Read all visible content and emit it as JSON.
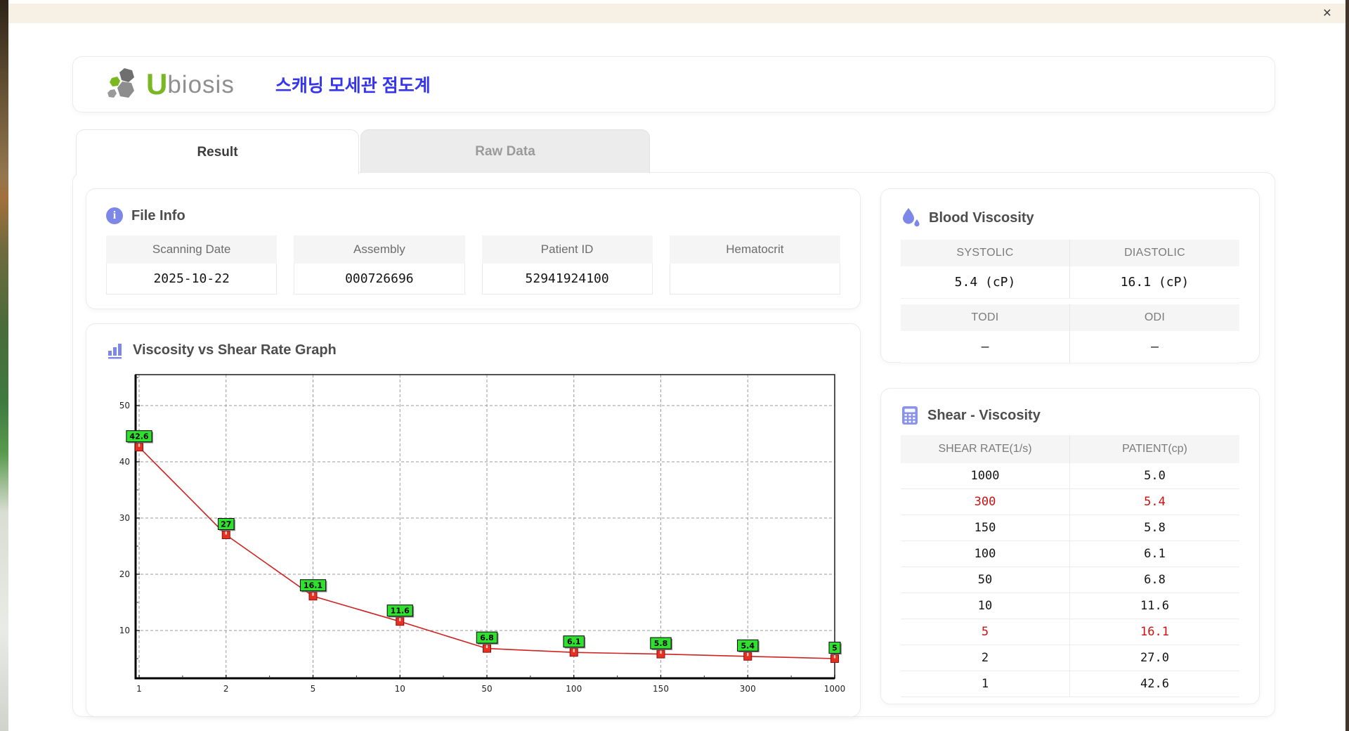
{
  "window": {
    "close_label": "×"
  },
  "header": {
    "logo_u": "U",
    "logo_rest": "biosis",
    "app_title": "스캐닝 모세관 점도계"
  },
  "tabs": [
    {
      "label": "Result",
      "active": true
    },
    {
      "label": "Raw Data",
      "active": false
    }
  ],
  "file_info": {
    "title": "File Info",
    "fields": [
      {
        "label": "Scanning Date",
        "value": "2025-10-22"
      },
      {
        "label": "Assembly",
        "value": "000726696"
      },
      {
        "label": "Patient ID",
        "value": "52941924100"
      },
      {
        "label": "Hematocrit",
        "value": ""
      }
    ]
  },
  "blood_viscosity": {
    "title": "Blood Viscosity",
    "metrics": [
      {
        "label": "SYSTOLIC",
        "value": "5.4 (cP)"
      },
      {
        "label": "DIASTOLIC",
        "value": "16.1 (cP)"
      },
      {
        "label": "TODI",
        "value": "–"
      },
      {
        "label": "ODI",
        "value": "–"
      }
    ]
  },
  "graph": {
    "title": "Viscosity vs Shear Rate Graph"
  },
  "chart_data": {
    "type": "line",
    "x_scale": "categorical",
    "categories": [
      "1",
      "2",
      "5",
      "10",
      "50",
      "100",
      "150",
      "300",
      "1000"
    ],
    "values": [
      42.6,
      27,
      16.1,
      11.6,
      6.8,
      6.1,
      5.8,
      5.4,
      5
    ],
    "point_labels": [
      "42.6",
      "27",
      "16.1",
      "11.6",
      "6.8",
      "6.1",
      "5.8",
      "5.4",
      "5"
    ],
    "title": "Viscosity vs Shear Rate Graph",
    "xlabel": "",
    "ylabel": "",
    "ylim": [
      1.5,
      55.5
    ],
    "yticks": [
      10,
      20,
      30,
      40,
      50
    ],
    "grid": true,
    "grid_style": "dashed",
    "line_color": "#cf2222",
    "marker_color": "#e43122",
    "marker_border": "#8b0f0f",
    "label_bg": "#2fe02f",
    "label_border": "#000000"
  },
  "shear_table": {
    "title": "Shear - Viscosity",
    "columns": [
      "SHEAR RATE(1/s)",
      "PATIENT(cp)"
    ],
    "highlight_color": "#cc1111",
    "rows": [
      {
        "shear_rate": "1000",
        "patient": "5.0",
        "highlight": false
      },
      {
        "shear_rate": "300",
        "patient": "5.4",
        "highlight": true
      },
      {
        "shear_rate": "150",
        "patient": "5.8",
        "highlight": false
      },
      {
        "shear_rate": "100",
        "patient": "6.1",
        "highlight": false
      },
      {
        "shear_rate": "50",
        "patient": "6.8",
        "highlight": false
      },
      {
        "shear_rate": "10",
        "patient": "11.6",
        "highlight": false
      },
      {
        "shear_rate": "5",
        "patient": "16.1",
        "highlight": true
      },
      {
        "shear_rate": "2",
        "patient": "27.0",
        "highlight": false
      },
      {
        "shear_rate": "1",
        "patient": "42.6",
        "highlight": false
      }
    ]
  }
}
